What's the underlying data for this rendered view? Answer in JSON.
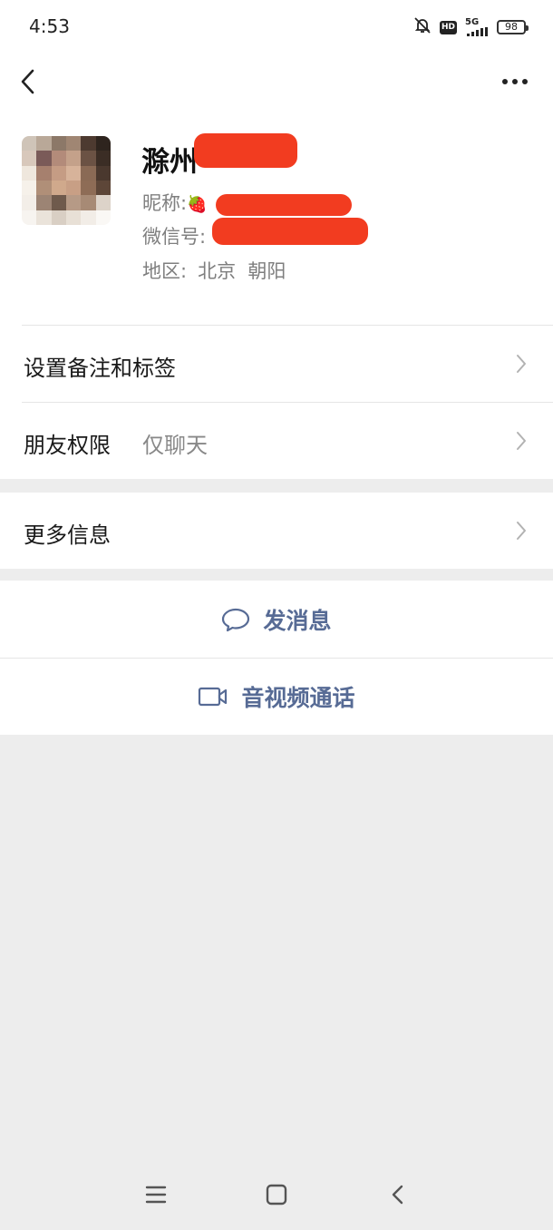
{
  "status_bar": {
    "time": "4:53",
    "network": "5G",
    "hd_label": "HD",
    "battery": "98",
    "icons": [
      "bell-muted-icon",
      "hd-icon",
      "signal-icon",
      "battery-icon"
    ]
  },
  "nav": {
    "back_icon": "chevron-left-icon",
    "more_icon": "ellipsis-icon"
  },
  "profile": {
    "name": "滁州",
    "nickname_label": "昵称:",
    "nickname_emoji": "🍓",
    "wechat_id_label": "微信号:",
    "region_label": "地区:",
    "region_value": "北京  朝阳"
  },
  "menu": {
    "remark_tags": "设置备注和标签",
    "friend_permission": "朋友权限",
    "friend_permission_value": "仅聊天",
    "more_info": "更多信息"
  },
  "actions": {
    "send_message": "发消息",
    "video_call": "音视频通话"
  },
  "colors": {
    "link": "#576b95",
    "background": "#ededed",
    "redaction": "#f23c20"
  }
}
